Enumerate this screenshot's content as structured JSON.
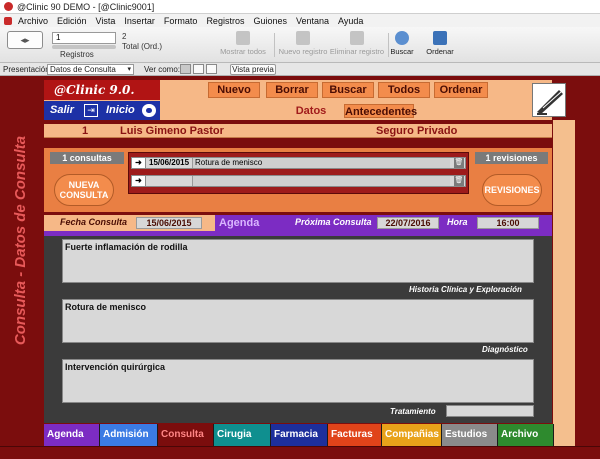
{
  "window": {
    "title": "@Clinic 90 DEMO - [@Clinic9001]"
  },
  "menu": [
    "Archivo",
    "Edición",
    "Vista",
    "Insertar",
    "Formato",
    "Registros",
    "Guiones",
    "Ventana",
    "Ayuda"
  ],
  "toolbar": {
    "record_number": "1",
    "records_label": "Registros",
    "total_count": "2",
    "total_label": "Total (Ord.)",
    "buttons": {
      "show_all": "Mostrar todos",
      "new_record": "Nuevo registro",
      "delete_record": "Eliminar registro",
      "find": "Buscar",
      "sort": "Ordenar"
    }
  },
  "layout_bar": {
    "presentation_label": "Presentación:",
    "presentation_value": "Datos de Consulta",
    "view_as_label": "Ver como:",
    "preview_label": "Vista previa"
  },
  "app": {
    "side_title": "Consulta - Datos de Consulta",
    "logo_text": "@Clinic 9.0.",
    "nav": {
      "exit": "Salir",
      "home": "Inicio"
    },
    "commands": {
      "new": "Nuevo",
      "delete": "Borrar",
      "find": "Buscar",
      "all": "Todos",
      "sort": "Ordenar"
    },
    "tabs": {
      "data": "Datos",
      "history": "Antecedentes"
    },
    "patient": {
      "id": "1",
      "name": "Luis Gimeno Pastor",
      "insurance": "Seguro Privado"
    },
    "consults_count_label": "1 consultas",
    "new_consult_label": "NUEVA CONSULTA",
    "revisions_count_label": "1 revisiones",
    "revisions_label": "REVISIONES",
    "consult_rows": [
      {
        "date": "15/06/2015",
        "description": "Rotura de menisco"
      },
      {
        "date": "",
        "description": ""
      }
    ],
    "fecha": {
      "date_label": "Fecha Consulta",
      "date_value": "15/06/2015",
      "agenda_label": "Agenda",
      "next_label": "Próxima Consulta",
      "next_value": "22/07/2016",
      "time_label": "Hora",
      "time_value": "16:00"
    },
    "fields": {
      "history_text": "Fuerte inflamación de rodilla",
      "history_caption": "Historia Clínica y Exploración",
      "diagnosis_text": "Rotura de menisco",
      "diagnosis_caption": "Diagnóstico",
      "treatment_text": "Intervención quirúrgica",
      "treatment_caption": "Tratamiento"
    },
    "bottom_tabs": [
      {
        "label": "Agenda",
        "bg": "#7c2cc3",
        "fg": "#ffffff"
      },
      {
        "label": "Admisión",
        "bg": "#3b7be4",
        "fg": "#ffffff"
      },
      {
        "label": "Consulta",
        "bg": "#7b0d0d",
        "fg": "#ff8585"
      },
      {
        "label": "Cirugia",
        "bg": "#0f8f8f",
        "fg": "#ffffff"
      },
      {
        "label": "Farmacia",
        "bg": "#1d2f9c",
        "fg": "#ffffff"
      },
      {
        "label": "Facturas",
        "bg": "#e0441a",
        "fg": "#ffffff"
      },
      {
        "label": "Compañias",
        "bg": "#e8a21a",
        "fg": "#ffffff"
      },
      {
        "label": "Estudios",
        "bg": "#8a8a8a",
        "fg": "#ffffff"
      },
      {
        "label": "Archivo",
        "bg": "#2e8a2e",
        "fg": "#ffffff"
      }
    ]
  }
}
